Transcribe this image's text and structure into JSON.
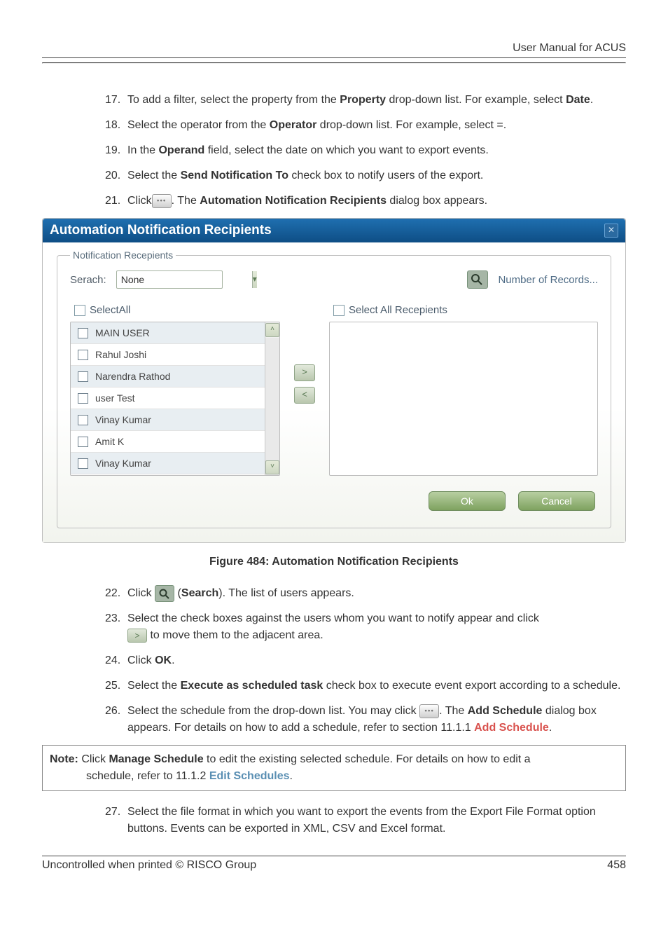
{
  "header": {
    "title": "User Manual for ACUS"
  },
  "steps_a": [
    {
      "num": "17.",
      "html": [
        "To add a filter, select the property from the ",
        {
          "b": "Property"
        },
        " drop-down list. For example, select ",
        {
          "b": "Date"
        },
        "."
      ]
    },
    {
      "num": "18.",
      "html": [
        "Select the operator from the ",
        {
          "b": "Operator"
        },
        " drop-down list. For example, select =."
      ]
    },
    {
      "num": "19.",
      "html": [
        "In the ",
        {
          "b": "Operand"
        },
        " field, select the date on which you want to export events."
      ]
    },
    {
      "num": "20.",
      "html": [
        "Select the ",
        {
          "b": "Send Notification To"
        },
        " check box to notify users of the export."
      ]
    },
    {
      "num": "21.",
      "html": [
        "Click",
        {
          "icon": "ellipsis"
        },
        ". The ",
        {
          "b": "Automation Notification Recipients"
        },
        " dialog box appears."
      ]
    }
  ],
  "dialog": {
    "title": "Automation Notification Recipients",
    "legend": "Notification Recepients",
    "search_label": "Serach:",
    "search_value": "None",
    "records_link": "Number of Records...",
    "select_all_left": "SelectAll",
    "select_all_right": "Select All Recepients",
    "users": [
      "MAIN USER",
      "Rahul Joshi",
      "Narendra Rathod",
      "user Test",
      "Vinay Kumar",
      "Amit K",
      "Vinay Kumar"
    ],
    "ok": "Ok",
    "cancel": "Cancel"
  },
  "figure_caption": "Figure 484: Automation Notification Recipients",
  "steps_b": [
    {
      "num": "22.",
      "html": [
        "Click ",
        {
          "icon": "search"
        },
        " (",
        {
          "b": "Search"
        },
        "). The list of users appears."
      ]
    },
    {
      "num": "23.",
      "html": [
        "Select the check boxes against the users whom you want to notify appear and click ",
        {
          "br": true
        },
        {
          "icon": "right-arrow"
        },
        " to move them to the adjacent area."
      ]
    },
    {
      "num": "24.",
      "html": [
        "Click ",
        {
          "b": "OK"
        },
        "."
      ]
    },
    {
      "num": "25.",
      "html": [
        "Select the ",
        {
          "b": "Execute as scheduled task"
        },
        " check box to execute event export according to a schedule."
      ]
    },
    {
      "num": "26.",
      "html": [
        "Select the schedule from the drop-down list. You may click ",
        {
          "icon": "ellipsis"
        },
        ". The ",
        {
          "b": "Add Schedule"
        },
        " dialog box appears. For details on how to add a schedule, refer to section 11.1.1 ",
        {
          "linkred": "Add Schedule"
        },
        "."
      ]
    }
  ],
  "note": {
    "prefix": "Note:",
    "line1": " Click ",
    "manage": "Manage Schedule",
    "line1b": " to edit the existing selected schedule. For details on how to edit a",
    "line2a": "schedule, refer to 11.1.2 ",
    "link": "Edit Schedules",
    "line2b": "."
  },
  "steps_c": [
    {
      "num": "27.",
      "html": [
        "Select the file format in which you want to export the events from the Export File Format option buttons. Events can be exported in XML, CSV and Excel format."
      ]
    }
  ],
  "footer": {
    "left": "Uncontrolled when printed © RISCO Group",
    "right": "458"
  }
}
